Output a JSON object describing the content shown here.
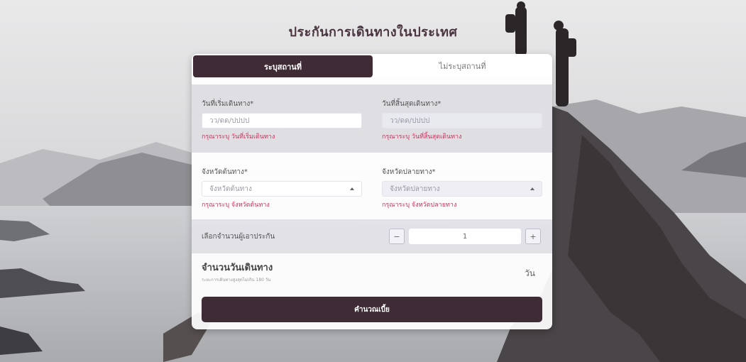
{
  "page_title": "ประกันการเดินทางในประเทศ",
  "tabs": [
    {
      "label": "ระบุสถานที่",
      "active": true
    },
    {
      "label": "ไม่ระบุสถานที่",
      "active": false
    }
  ],
  "dates": {
    "start_label": "วันที่เริ่มเดินทาง*",
    "start_placeholder": "วว/ดด/ปปปป",
    "start_error": "กรุณาระบุ วันที่เริ่มเดินทาง",
    "end_label": "วันที่สิ้นสุดเดินทาง*",
    "end_placeholder": "วว/ดด/ปปปป",
    "end_error": "กรุณาระบุ วันที่สิ้นสุดเดินทาง"
  },
  "provinces": {
    "origin_label": "จังหวัดต้นทาง*",
    "origin_value": "จังหวัดต้นทาง",
    "origin_error": "กรุณาระบุ จังหวัดต้นทาง",
    "dest_label": "จังหวัดปลายทาง*",
    "dest_value": "จังหวัดปลายทาง",
    "dest_error": "กรุณาระบุ จังหวัดปลายทาง"
  },
  "insured": {
    "label": "เลือกจำนวนผู้เอาประกัน",
    "minus": "−",
    "value": "1",
    "plus": "+"
  },
  "days": {
    "title": "จำนวนวันเดินทาง",
    "subtitle": "ระยะการเดินทางสูงสุดไม่เกิน 180 วัน",
    "unit": "วัน"
  },
  "calculate_label": "คำนวณเบี้ย",
  "colors": {
    "brand_dark": "#3e2b35",
    "error": "#c4345a"
  }
}
